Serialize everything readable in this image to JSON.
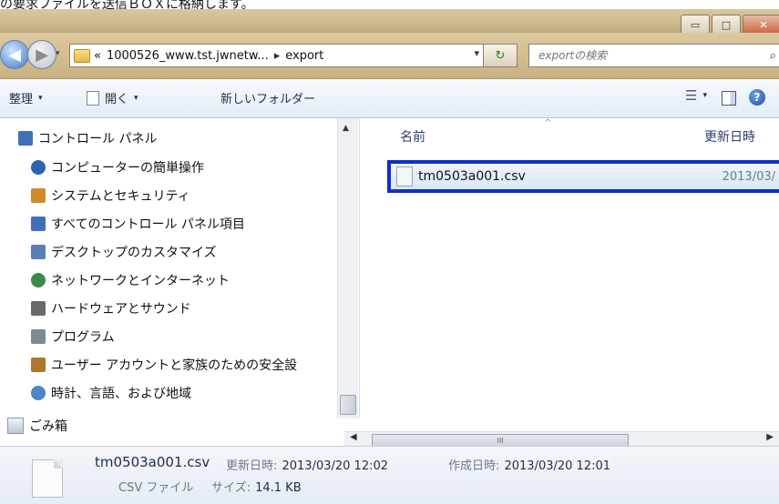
{
  "caption": "の要求ファイルを送信ＢＯＸに格納します。",
  "window": {
    "controls": {
      "minimize": "▭",
      "maximize": "□",
      "close": "✕"
    }
  },
  "address_bar": {
    "overflow": "«",
    "path_parent": "1000526_www.tst.jwnetw...",
    "separator": "▸",
    "path_current": "export",
    "dropdown": "▾",
    "refresh": "↻",
    "search_placeholder": "exportの検索",
    "search_icon": "magnifier-icon"
  },
  "toolbar": {
    "organize": "整理",
    "open": "開く",
    "new_folder": "新しいフォルダー",
    "caret": "▾"
  },
  "nav_pane": {
    "items": [
      {
        "label": "コントロール パネル",
        "icon": "control-panel-icon",
        "color": "#3f6fb7"
      },
      {
        "label": "コンピューターの簡単操作",
        "icon": "ease-of-access-icon",
        "color": "#2f63b0"
      },
      {
        "label": "システムとセキュリティ",
        "icon": "shield-icon",
        "color": "#d08a2a"
      },
      {
        "label": "すべてのコントロール パネル項目",
        "icon": "control-panel-icon",
        "color": "#3f6fb7"
      },
      {
        "label": "デスクトップのカスタマイズ",
        "icon": "monitor-icon",
        "color": "#5a7fb5"
      },
      {
        "label": "ネットワークとインターネット",
        "icon": "network-icon",
        "color": "#3b8a4a"
      },
      {
        "label": "ハードウェアとサウンド",
        "icon": "printer-icon",
        "color": "#6a6a6a"
      },
      {
        "label": "プログラム",
        "icon": "programs-icon",
        "color": "#7d8a96"
      },
      {
        "label": "ユーザー アカウントと家族のための安全設",
        "icon": "users-icon",
        "color": "#b0752f"
      },
      {
        "label": "時計、言語、および地域",
        "icon": "clock-globe-icon",
        "color": "#4a86c8"
      }
    ],
    "recycle_bin": "ごみ箱"
  },
  "file_list": {
    "columns": {
      "name": "名前",
      "modified": "更新日時"
    },
    "sort_indicator": "^",
    "files": [
      {
        "name": "tm0503a001.csv",
        "modified": "2013/03/"
      }
    ]
  },
  "details": {
    "file_name": "tm0503a001.csv",
    "modified_label": "更新日時:",
    "modified_value": "2013/03/20 12:02",
    "created_label": "作成日時:",
    "created_value": "2013/03/20 12:01",
    "type": "CSV ファイル",
    "size_label": "サイズ:",
    "size_value": "14.1 KB"
  }
}
